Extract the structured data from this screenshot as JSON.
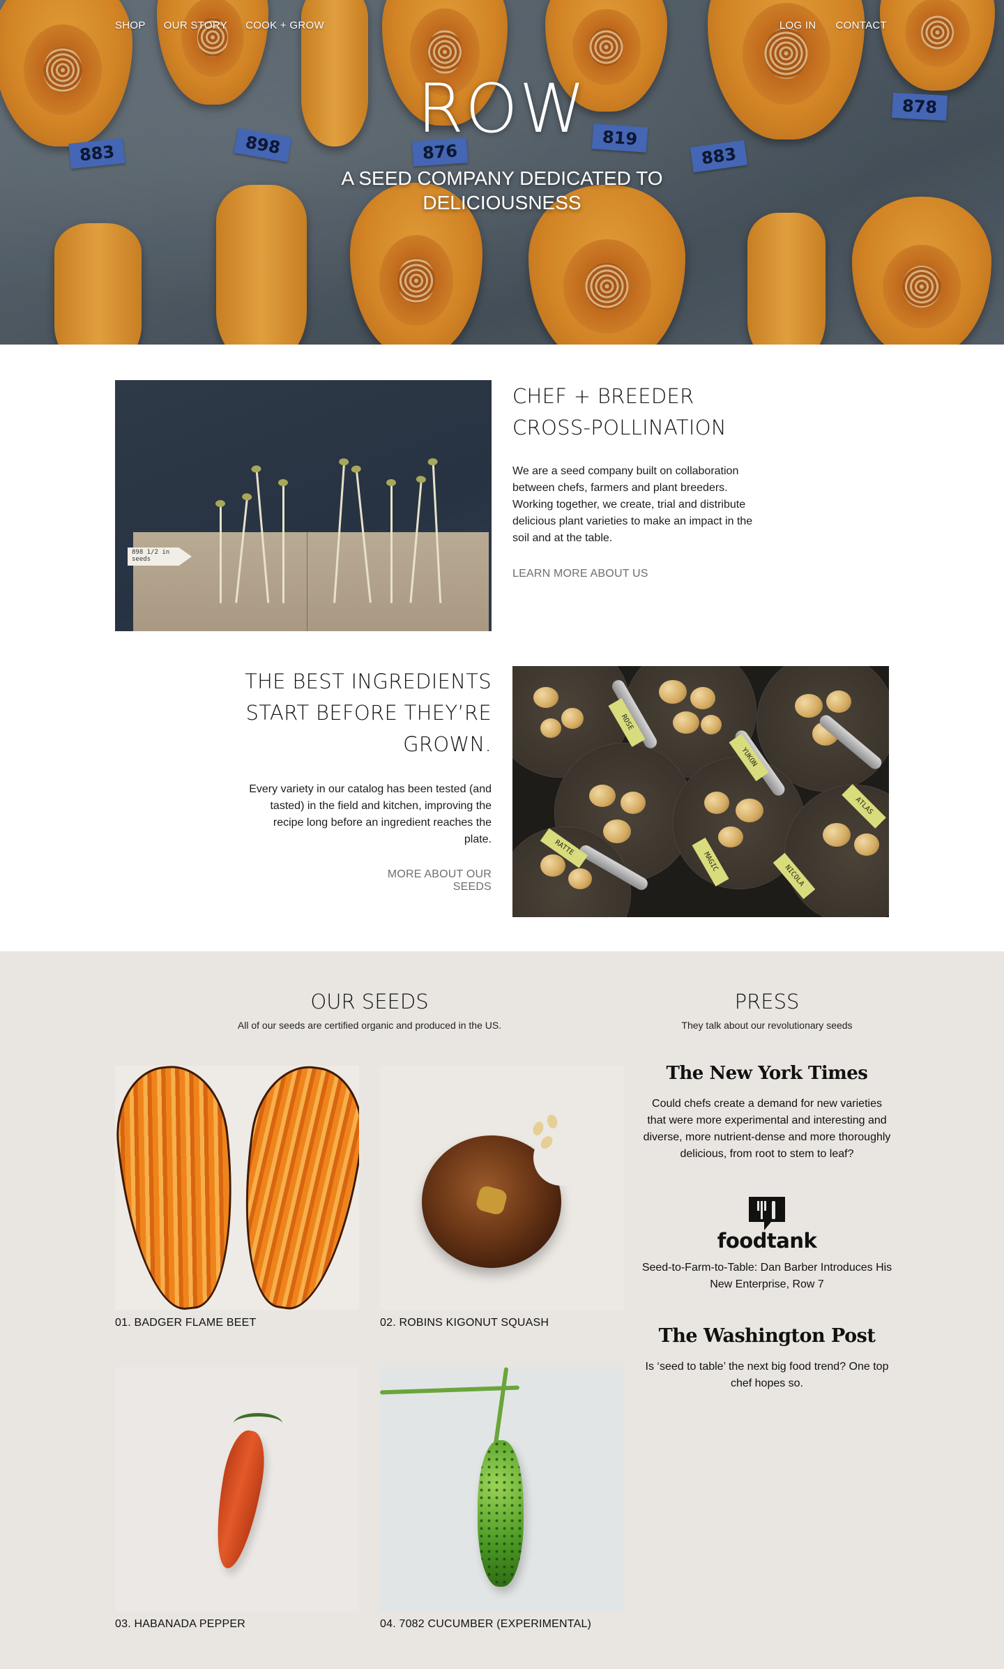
{
  "nav": {
    "left": [
      "SHOP",
      "OUR STORY",
      "COOK + GROW"
    ],
    "right": [
      "LOG IN",
      "CONTACT"
    ]
  },
  "hero": {
    "title": "ROW",
    "subtitle": "A SEED COMPANY DEDICATED TO DELICIOUSNESS",
    "tape_labels": [
      "883",
      "898",
      "876",
      "819",
      "883",
      "878"
    ]
  },
  "intro": {
    "heading": "CHEF + BREEDER CROSS-POLLINATION",
    "heading_line1": "CHEF + BREEDER",
    "heading_line2": "CROSS-POLLINATION",
    "body": "We are a seed company built on collaboration between chefs, farmers and plant breeders. Working together, we create, trial and distribute delicious plant varieties to make an impact in the soil and at the table.",
    "link": "LEARN MORE ABOUT US",
    "image_label": "898 1/2 in seeds"
  },
  "ingredients": {
    "heading_line1": "THE BEST INGREDIENTS",
    "heading_line2": "START BEFORE THEY’RE",
    "heading_line3": "GROWN.",
    "body": "Every variety in our catalog has been tested (and tasted) in the field and kitchen, improving the recipe long before an ingredient reaches the plate.",
    "link": "MORE ABOUT OUR SEEDS",
    "pan_labels": [
      "ROSE",
      "YUKON",
      "RATTE",
      "MAGIC",
      "NICOLA",
      "ATLAS"
    ]
  },
  "seeds": {
    "title": "OUR SEEDS",
    "subtitle": "All of our seeds are certified organic and produced in the US.",
    "items": [
      {
        "caption": "01. BADGER FLAME BEET"
      },
      {
        "caption": "02. ROBINS KIGONUT SQUASH"
      },
      {
        "caption": "03. HABANADA PEPPER"
      },
      {
        "caption": "04. 7082 CUCUMBER (EXPERIMENTAL)"
      }
    ]
  },
  "press": {
    "title": "PRESS",
    "subtitle": "They talk about our revolutionary seeds",
    "items": [
      {
        "outlet": "The New York Times",
        "quote": "Could chefs create a demand for new varieties that were more experimental and interesting and diverse, more nutrient-dense and more thoroughly delicious, from root to stem to leaf?"
      },
      {
        "outlet": "foodtank",
        "quote": "Seed-to-Farm-to-Table: Dan Barber Introduces His New Enterprise, Row 7"
      },
      {
        "outlet": "The Washington Post",
        "quote": "Is ‘seed to table’ the next big food trend? One top chef hopes so."
      }
    ]
  },
  "colors": {
    "gray_section": "#e9e6e1",
    "link_gray": "#6e6e6e",
    "squash_orange": "#e5912a",
    "tape_blue": "#4a6fc4"
  }
}
